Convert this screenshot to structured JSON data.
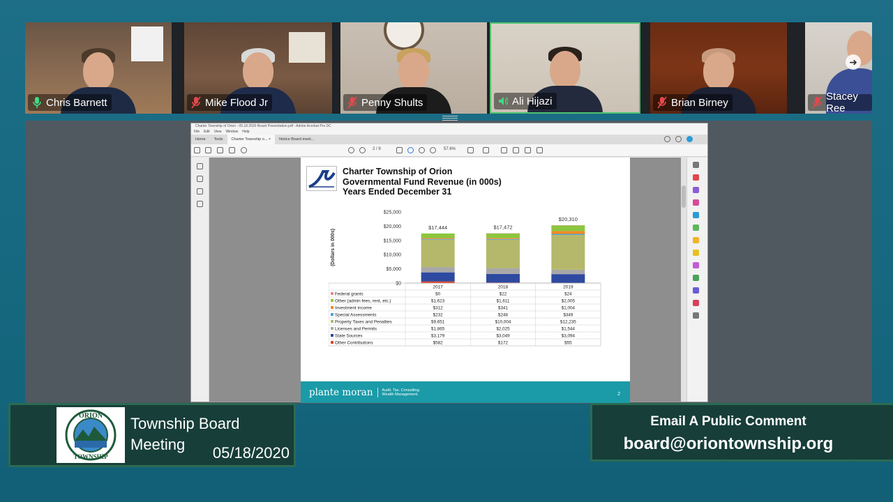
{
  "participants": [
    {
      "name": "Chris Barnett",
      "mic": "active"
    },
    {
      "name": "Mike Flood Jr",
      "mic": "muted"
    },
    {
      "name": "Penny Shults",
      "mic": "muted"
    },
    {
      "name": "Ali Hijazi",
      "mic": "speaking"
    },
    {
      "name": "Brian Birney",
      "mic": "muted"
    },
    {
      "name": "Stacey Ree",
      "mic": "muted"
    }
  ],
  "acrobat": {
    "window_title": "Charter Township of Orion - 05.18.2020 Board Presentation.pdf - Adobe Acrobat Pro DC",
    "menu": [
      "File",
      "Edit",
      "View",
      "Window",
      "Help"
    ],
    "tabs": {
      "home": "Home",
      "tools": "Tools",
      "doc1": "Charter Township o...",
      "doc2": "Notice Board meet..."
    },
    "page_indicator": "2 / 9",
    "zoom": "57.6%"
  },
  "slide": {
    "title_line1": "Charter Township of Orion",
    "title_line2": "Governmental Fund Revenue (in 000s)",
    "title_line3": "Years Ended December 31",
    "footer_brand": "plante moran",
    "footer_tagline_1": "Audit. Tax. Consulting.",
    "footer_tagline_2": "Wealth Management.",
    "page_number": "2"
  },
  "chart_data": {
    "type": "bar",
    "stacked": true,
    "ylabel": "(Dollars in 000s)",
    "ylim": [
      0,
      25000
    ],
    "y_ticks": [
      "$25,000",
      "$20,000",
      "$15,000",
      "$10,000",
      "$5,000",
      "$0"
    ],
    "y_tick_values": [
      25000,
      20000,
      15000,
      10000,
      5000,
      0
    ],
    "categories": [
      "2017",
      "2018",
      "2019"
    ],
    "totals": [
      "$17,444",
      "$17,472",
      "$20,310"
    ],
    "series": [
      {
        "name": "Federal grants",
        "color": "#e88a8a",
        "values": [
          0,
          22,
          24
        ],
        "labels": [
          "$0",
          "$22",
          "$24"
        ]
      },
      {
        "name": "Other (admin fees, rent, etc.)",
        "color": "#8cc63f",
        "values": [
          1623,
          1611,
          2005
        ],
        "labels": [
          "$1,623",
          "$1,611",
          "$2,005"
        ]
      },
      {
        "name": "Investment income",
        "color": "#f08a24",
        "values": [
          312,
          341,
          1004
        ],
        "labels": [
          "$312",
          "$341",
          "$1,004"
        ]
      },
      {
        "name": "Special Assessments",
        "color": "#4aa3d8",
        "values": [
          232,
          248,
          349
        ],
        "labels": [
          "$232",
          "$248",
          "$349"
        ]
      },
      {
        "name": "Property Taxes and Penalties",
        "color": "#b5b86a",
        "values": [
          9651,
          10004,
          12235
        ],
        "labels": [
          "$9,651",
          "$10,004",
          "$12,235"
        ]
      },
      {
        "name": "Licenses and Permits",
        "color": "#a8a8a8",
        "values": [
          1865,
          2025,
          1544
        ],
        "labels": [
          "$1,865",
          "$2,025",
          "$1,544"
        ]
      },
      {
        "name": "State Sources",
        "color": "#2e4aa0",
        "values": [
          3179,
          3049,
          3094
        ],
        "labels": [
          "$3,179",
          "$3,049",
          "$3,094"
        ]
      },
      {
        "name": "Other Contributions",
        "color": "#e0442a",
        "values": [
          582,
          172,
          55
        ],
        "labels": [
          "$582",
          "$172",
          "$55"
        ]
      }
    ]
  },
  "lower_third": {
    "title_line1": "Township Board",
    "title_line2": "Meeting",
    "date": "05/18/2020",
    "seal_top": "ORION",
    "seal_bottom": "TOWNSHIP",
    "email_label": "Email A Public Comment",
    "email": "board@oriontownship.org"
  },
  "colors": {
    "mic_active": "#3ddc84",
    "mic_muted": "#e5484d",
    "accent_teal": "#1b9aa8"
  }
}
